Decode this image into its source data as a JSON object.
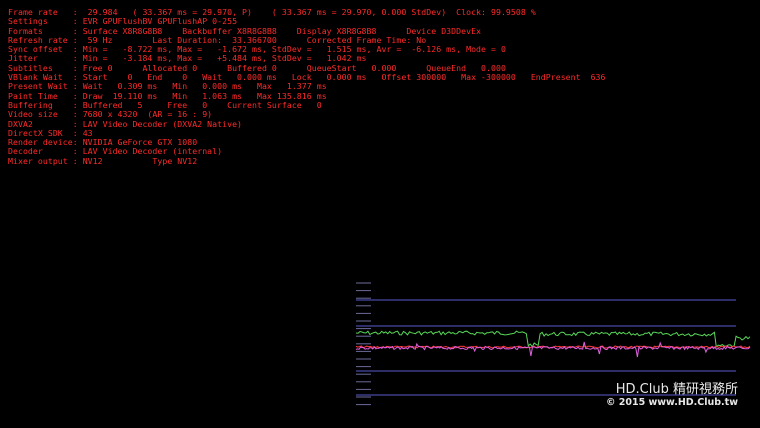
{
  "stats_lines": [
    "Frame rate   :  29.984   ( 33.367 ms = 29.970, P)    ( 33.367 ms = 29.970, 0.000 StdDev)  Clock: 99.9508 %",
    "Settings     : EVR GPUFlushBV GPUFlushAP 0-255",
    "Formats      : Surface X8R8G8B8    Backbuffer X8R8G8B8    Display X8R8G8B8      Device D3DDevEx",
    "Refresh rate :  59 Hz        Last Duration:  33.366700      Corrected Frame Time: No",
    "Sync offset  : Min =   -8.722 ms, Max =   -1.672 ms, StdDev =   1.515 ms, Avr =  -6.126 ms, Mode = 0",
    "Jitter       : Min =   -3.184 ms, Max =   +5.484 ms, StdDev =   1.042 ms",
    "Subtitles    : Free 0      Allocated 0      Buffered 0      QueueStart   0.000      QueueEnd   0.000",
    "VBlank Wait  : Start    0   End    0   Wait   0.000 ms   Lock   0.000 ms   Offset 300000   Max -300000   EndPresent  636",
    "Present Wait : Wait   0.309 ms   Min   0.000 ms   Max   1.377 ms",
    "Paint Time   : Draw  19.110 ms   Min   1.063 ms   Max 135.816 ms",
    "Buffering    : Buffered   5     Free   0    Current Surface   0",
    "Video size   : 7680 x 4320  (AR = 16 : 9)",
    "DXVA2        : LAV Video Decoder (DXVA2 Native)",
    "DirectX SDK  : 43",
    "Render device: NVIDIA GeForce GTX 1080",
    "Decoder      : LAV Video Decoder (internal)",
    "Mixer output : NV12          Type NV12"
  ],
  "watermark": {
    "line1": "HD.Club 精研視務所",
    "line2": "© 2015  www.HD.Club.tw"
  },
  "colors": {
    "stats_text": "#ff2a2a",
    "graph_ticks": "#8f8fcf",
    "graph_lines": "#5a5ad0",
    "green_series": "#58d858",
    "red_series": "#ff3a3a",
    "magenta_series": "#e060e0",
    "watermark": "#e8e8e8"
  }
}
